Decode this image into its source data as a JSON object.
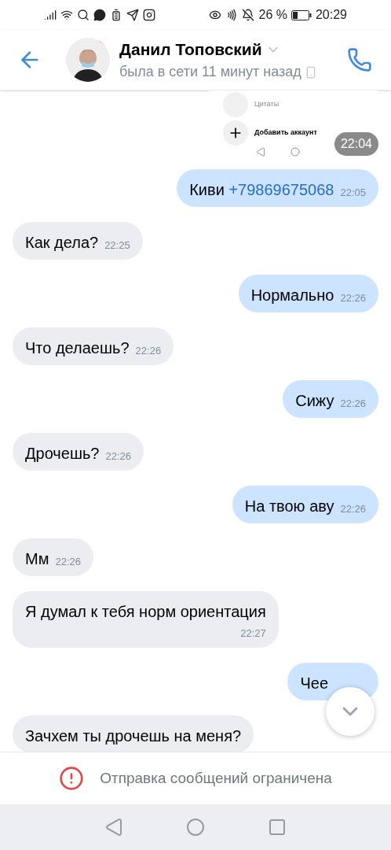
{
  "status_bar": {
    "battery": "26 %",
    "time": "20:29"
  },
  "header": {
    "name": "Данил Топовский",
    "status": "была в сети 11 минут назад"
  },
  "image_message": {
    "items": [
      {
        "kind": "profile",
        "label": "Цитаты"
      },
      {
        "kind": "add",
        "label": "Добавить аккаунт"
      }
    ],
    "time": "22:04"
  },
  "messages": [
    {
      "kind": "out",
      "text": "Киви",
      "link": "+79869675068",
      "time": "22:05"
    },
    {
      "kind": "in",
      "text": "Как дела?",
      "time": "22:25"
    },
    {
      "kind": "out",
      "text": "Нормально",
      "time": "22:26"
    },
    {
      "kind": "in",
      "text": "Что делаешь?",
      "time": "22:26"
    },
    {
      "kind": "out",
      "text": "Сижу",
      "time": "22:26"
    },
    {
      "kind": "in",
      "text": "Дрочешь?",
      "time": "22:26"
    },
    {
      "kind": "out",
      "text": "На твою аву",
      "time": "22:26"
    },
    {
      "kind": "in",
      "text": "Мм",
      "time": "22:26"
    },
    {
      "kind": "in",
      "text": "Я думал к тебя норм ориентация",
      "time": "22:27",
      "wide": true
    },
    {
      "kind": "out",
      "text": "Чее"
    },
    {
      "kind": "in",
      "text": "Зачхем ты дрочешь на меня?"
    }
  ],
  "notice": {
    "text": "Отправка сообщений ограничена"
  }
}
